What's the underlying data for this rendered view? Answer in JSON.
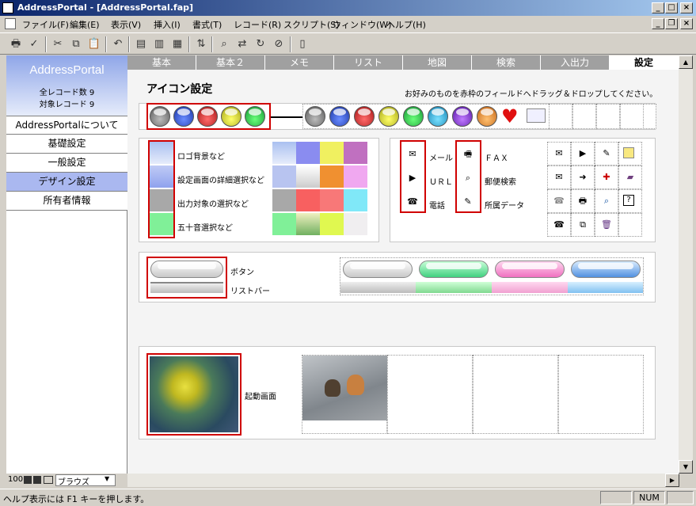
{
  "window": {
    "title": "AddressPortal - [AddressPortal.fap]"
  },
  "menu": [
    "ファイル(F)",
    "編集(E)",
    "表示(V)",
    "挿入(I)",
    "書式(T)",
    "レコード(R)",
    "スクリプト(S)",
    "ウィンドウ(W)",
    "ヘルプ(H)"
  ],
  "sidebar": {
    "logo": "AddressPortal",
    "total_records": "全レコード数 9",
    "found_records": "対象レコード 9",
    "items": [
      "AddressPortalについて",
      "基礎設定",
      "一般設定",
      "デザイン設定",
      "所有者情報"
    ]
  },
  "tabs": [
    "基本",
    "基本２",
    "メモ",
    "リスト",
    "地図",
    "検索",
    "入出力",
    "設定"
  ],
  "content": {
    "heading": "アイコン設定",
    "instruction": "お好みのものを赤枠のフィールドへドラッグ＆ドロップしてください。",
    "color_labels": [
      "ロゴ背景など",
      "設定画面の詳細選択など",
      "出力対象の選択など",
      "五十音選択など"
    ],
    "icon_labels": {
      "mail": "メール",
      "url": "ＵＲＬ",
      "phone": "電話",
      "fax": "ＦＡＸ",
      "zip": "郵便検索",
      "belong": "所属データ"
    },
    "button_labels": {
      "button": "ボタン",
      "listbar": "リストバー"
    },
    "startup_label": "起動画面"
  },
  "status": {
    "help": "ヘルプ表示には F1 キーを押します。",
    "num": "NUM",
    "zoom": "100",
    "mode": "ブラウズ"
  },
  "colors": {
    "accent_red": "#d00000",
    "active_side": "#aab8f0"
  }
}
